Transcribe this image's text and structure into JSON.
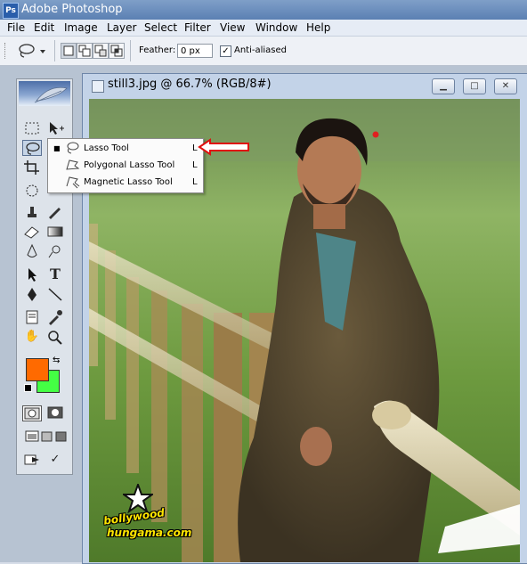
{
  "app": {
    "title": "Adobe Photoshop",
    "logo_text": "Ps"
  },
  "menu": [
    "File",
    "Edit",
    "Image",
    "Layer",
    "Select",
    "Filter",
    "View",
    "Window",
    "Help"
  ],
  "options": {
    "feather_label": "Feather:",
    "feather_value": "0 px",
    "antialias_label": "Anti-aliased",
    "antialias_checked": true
  },
  "document": {
    "title": "still3.jpg @ 66.7% (RGB/8#)"
  },
  "flyout": {
    "items": [
      {
        "label": "Lasso Tool",
        "key": "L",
        "selected": true,
        "icon": "lasso-icon"
      },
      {
        "label": "Polygonal Lasso Tool",
        "key": "L",
        "selected": false,
        "icon": "polygonal-lasso-icon"
      },
      {
        "label": "Magnetic Lasso Tool",
        "key": "L",
        "selected": false,
        "icon": "magnetic-lasso-icon"
      }
    ]
  },
  "colors": {
    "foreground": "#ff6a00",
    "background": "#44ff44",
    "annotation_arrow": "#e01010"
  },
  "watermark": {
    "line1": "bollywood",
    "line2": "hungama.com"
  }
}
